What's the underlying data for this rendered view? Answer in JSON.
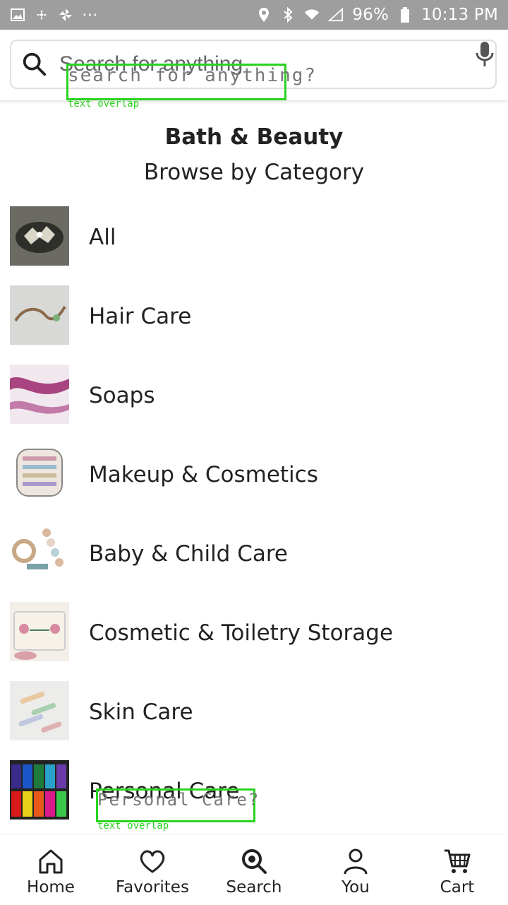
{
  "status_bar": {
    "battery": "96%",
    "time": "10:13 PM",
    "dots": "⋯"
  },
  "search": {
    "placeholder": "Search for anything",
    "overlay_text": "search for anything?",
    "overlay_tag": "text overlap"
  },
  "header": {
    "title": "Bath & Beauty",
    "subtitle": "Browse by Category"
  },
  "categories": [
    {
      "label": "All"
    },
    {
      "label": "Hair Care"
    },
    {
      "label": "Soaps"
    },
    {
      "label": "Makeup & Cosmetics"
    },
    {
      "label": "Baby & Child Care"
    },
    {
      "label": "Cosmetic & Toiletry Storage"
    },
    {
      "label": "Skin Care"
    },
    {
      "label": "Personal Care"
    }
  ],
  "personal_overlay": {
    "text": "Personal Care?",
    "tag": "text overlap"
  },
  "nav": [
    {
      "label": "Home",
      "icon": "home-icon"
    },
    {
      "label": "Favorites",
      "icon": "heart-icon"
    },
    {
      "label": "Search",
      "icon": "search-icon"
    },
    {
      "label": "You",
      "icon": "user-icon"
    },
    {
      "label": "Cart",
      "icon": "cart-icon"
    }
  ]
}
